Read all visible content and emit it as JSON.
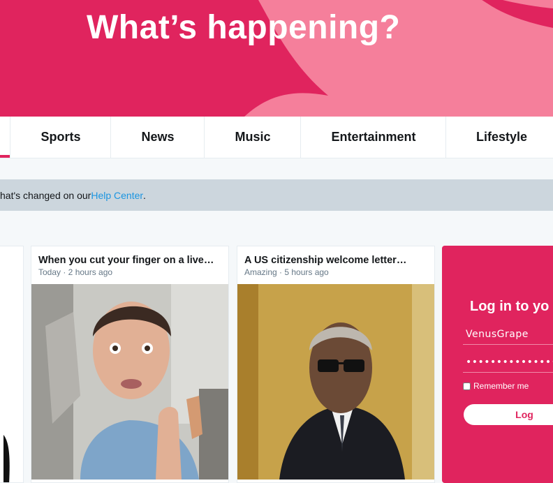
{
  "hero": {
    "title": "What’s happening?"
  },
  "nav": {
    "items": [
      {
        "label": "Sports"
      },
      {
        "label": "News"
      },
      {
        "label": "Music"
      },
      {
        "label": "Entertainment"
      },
      {
        "label": "Lifestyle"
      }
    ]
  },
  "notice": {
    "text": "hat's changed on our ",
    "link": "Help Center",
    "end": "."
  },
  "cards": [
    {
      "title": "When you cut your finger on a live…",
      "meta": "Today · 2 hours ago"
    },
    {
      "title": "A US citizenship welcome letter…",
      "meta": "Amazing · 5 hours ago"
    }
  ],
  "login": {
    "title": "Log in to yo",
    "username_value": "VenusGrape",
    "password_value": "••••••••••••••••••••••••",
    "remember_label": "Remember me",
    "button_label": "Log"
  },
  "colors": {
    "brand": "#e0245e",
    "link": "#1b95e0"
  }
}
